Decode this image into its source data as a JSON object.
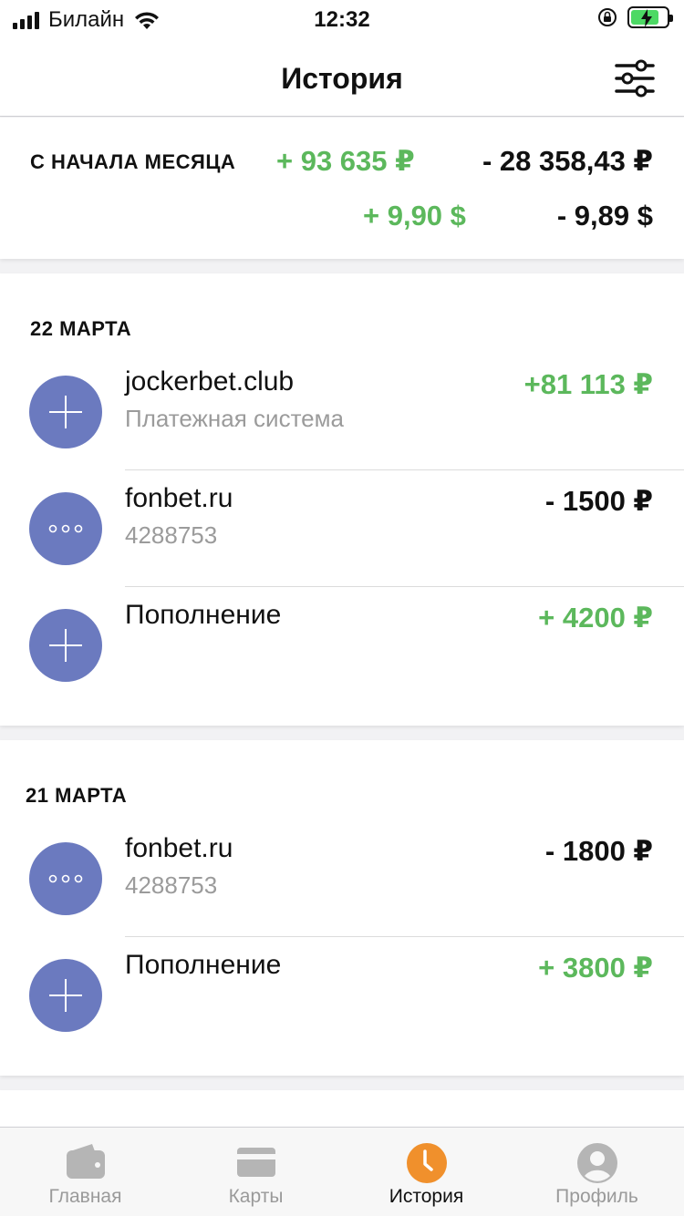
{
  "status_bar": {
    "carrier": "Билайн",
    "time": "12:32"
  },
  "header": {
    "title": "История",
    "filter_icon": "sliders-icon"
  },
  "summary": {
    "label": "С НАЧАЛА МЕСЯЦА",
    "income_rub": "+ 93 635 ₽",
    "expense_rub": "- 28 358,43 ₽",
    "income_usd": "+ 9,90 $",
    "expense_usd": "- 9,89 $"
  },
  "days": [
    {
      "date": "22 МАРТА",
      "transactions": [
        {
          "title": "jockerbet.club",
          "subtitle": "Платежная система",
          "amount": "+81 113 ₽",
          "type": "income",
          "icon": "plus-icon"
        },
        {
          "title": "fonbet.ru",
          "subtitle": "4288753",
          "amount": "- 1500 ₽",
          "type": "expense",
          "icon": "more-icon"
        },
        {
          "title": "Пополнение",
          "subtitle": "",
          "amount": "+ 4200 ₽",
          "type": "income",
          "icon": "plus-icon"
        }
      ]
    },
    {
      "date": "21 МАРТА",
      "transactions": [
        {
          "title": "fonbet.ru",
          "subtitle": "4288753",
          "amount": "- 1800 ₽",
          "type": "expense",
          "icon": "more-icon"
        },
        {
          "title": "Пополнение",
          "subtitle": "",
          "amount": "+ 3800 ₽",
          "type": "income",
          "icon": "plus-icon"
        }
      ]
    }
  ],
  "tabbar": {
    "items": [
      {
        "label": "Главная",
        "icon": "wallet-icon"
      },
      {
        "label": "Карты",
        "icon": "card-icon"
      },
      {
        "label": "История",
        "icon": "clock-icon",
        "active": true
      },
      {
        "label": "Профиль",
        "icon": "profile-icon"
      }
    ]
  },
  "colors": {
    "income": "#5cb85c",
    "expense": "#111111",
    "icon_bg": "#6b7abf",
    "active_tab": "#f0902c"
  }
}
